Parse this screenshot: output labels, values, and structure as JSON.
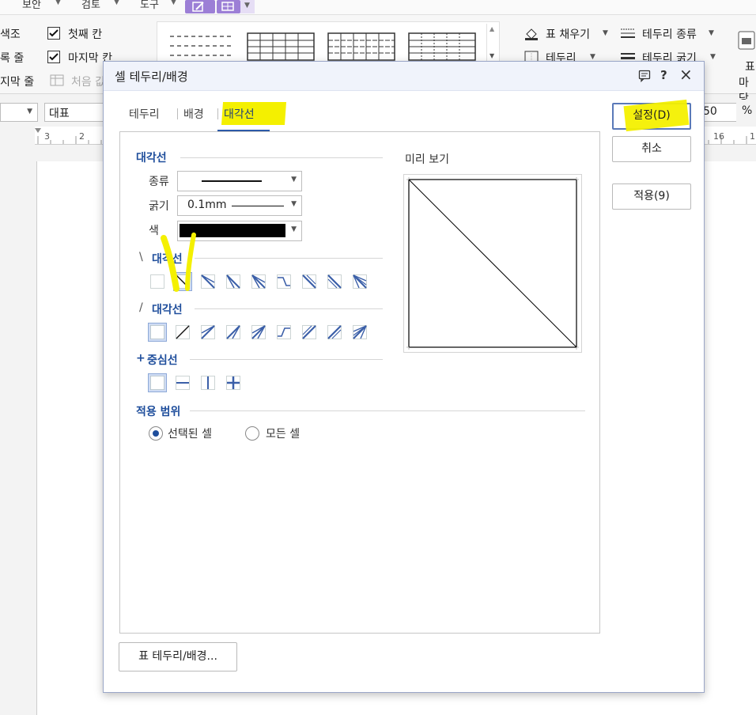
{
  "menubar": {
    "items": [
      "보안",
      "검토",
      "도구"
    ]
  },
  "ribbon": {
    "left_labels": [
      "색조",
      "록 줄",
      "지막 줄"
    ],
    "checkboxes": [
      {
        "label": "첫째 칸",
        "checked": true
      },
      {
        "label": "마지막 칸",
        "checked": true
      },
      {
        "label": "처음 값",
        "checked": false
      }
    ],
    "right_items": [
      {
        "label": "표 채우기"
      },
      {
        "label": "테두리 종류"
      },
      {
        "label": "테두리"
      },
      {
        "label": "테두리 굵기"
      }
    ],
    "far_right_label_1": "표",
    "far_right_label_2": "마당"
  },
  "format_bar": {
    "style_value": "대표",
    "zoom_value": "50",
    "zoom_unit": "%"
  },
  "ruler": {
    "left_ticks": [
      "3",
      "2"
    ],
    "right_ticks": [
      "16",
      "1"
    ]
  },
  "dialog": {
    "title": "셀 테두리/배경",
    "icons": {
      "help_chat": "chat-icon",
      "help": "?",
      "close": "×"
    },
    "tabs": [
      {
        "label": "테두리",
        "active": false
      },
      {
        "label": "배경",
        "active": false
      },
      {
        "label": "대각선",
        "active": true
      }
    ],
    "diagonal_section": {
      "title": "대각선",
      "type_label": "종류",
      "thickness_label": "굵기",
      "thickness_value": "0.1mm",
      "color_label": "색",
      "color_value": "#000000"
    },
    "backslash_section": {
      "prefix": "\\",
      "title": "대각선",
      "selected_index": 1
    },
    "slash_section": {
      "prefix": "/",
      "title": "대각선",
      "selected_index": 0
    },
    "center_section": {
      "prefix": "+",
      "title": "중심선",
      "selected_index": 0
    },
    "apply_scope": {
      "title": "적용 범위",
      "options": [
        {
          "label": "선택된 셀",
          "selected": true
        },
        {
          "label": "모든 셀",
          "selected": false
        }
      ]
    },
    "preview": {
      "title": "미리 보기"
    },
    "buttons": {
      "ok": "설정(D)",
      "cancel": "취소",
      "apply": "적용(9)",
      "table_border": "표 테두리/배경..."
    },
    "accent_color": "#1f4e9c",
    "highlight_color": "#f4f000"
  }
}
